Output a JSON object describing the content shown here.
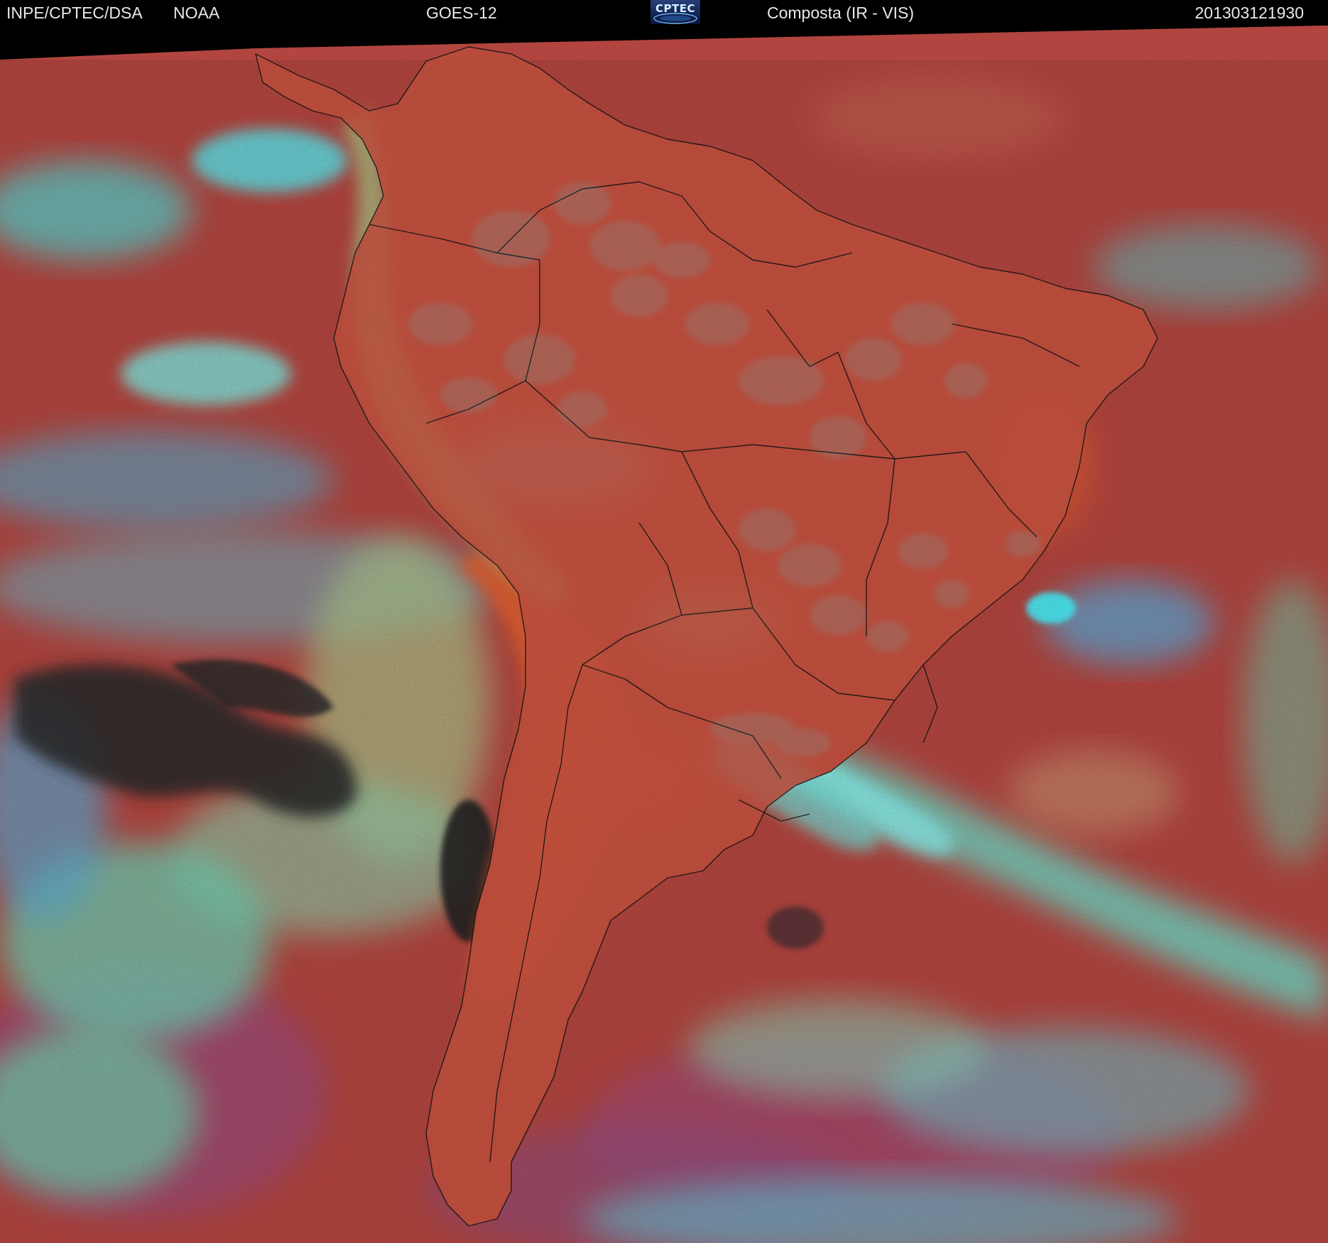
{
  "header": {
    "organization": "INPE/CPTEC/DSA",
    "agency": "NOAA",
    "satellite": "GOES-12",
    "logo_text": "CPTEC",
    "product": "Composta (IR - VIS)",
    "timestamp": "201303121930"
  },
  "map": {
    "region": "South America",
    "colors": {
      "clear_ocean": "#b2453f",
      "warm_land": "#d9542c",
      "high_cloud": "#40e6f5",
      "mid_cloud": "#7fd6a0",
      "low_cloud": "#9cc07a",
      "dark_cloud": "#282828",
      "boundary_lines": "#111111"
    }
  }
}
